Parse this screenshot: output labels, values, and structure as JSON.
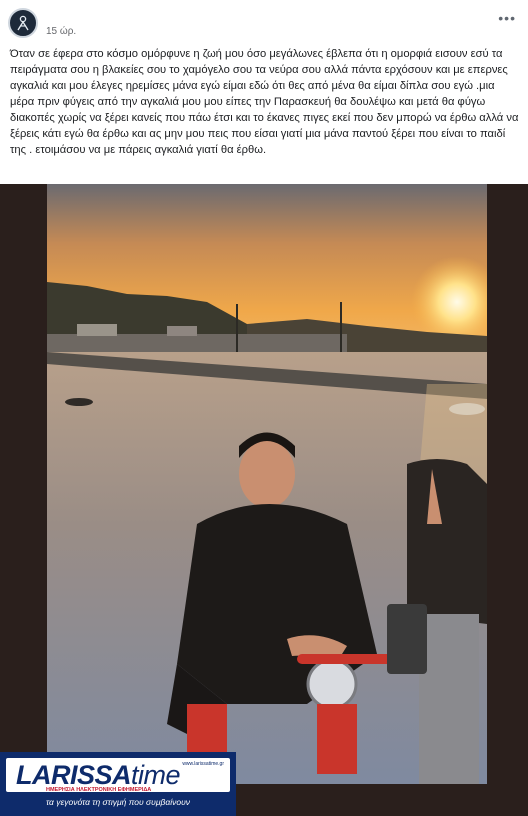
{
  "post": {
    "timestamp": "15 ώρ.",
    "more_icon": "more-horizontal-icon",
    "more_label": "•••",
    "text": "Όταν σε έφερα στο κόσμο ομόρφυνε η ζωή μου όσο μεγάλωνες έβλεπα ότι η ομορφιά εισουν εσύ τα πειράγματα σου η βλακείες σου το χαμόγελο σου τα νεύρα σου αλλά πάντα ερχόσουν και με επερνες αγκαλιά και μου έλεγες ηρεμίσες μάνα εγώ είμαι εδώ ότι θες από μένα θα είμαι δίπλα σου εγώ .μια μέρα πριν φύγεις από την αγκαλιά μου μου είπες την Παρασκευή θα δουλέψω και μετά θα φύγω διακοπές χωρίς να ξέρει κανείς που πάω έτσι και το έκανες πιγες εκεί που δεν μπορώ να έρθω αλλά να ξέρεις κάτι εγώ θα έρθω και ας μην μου πεις που είσαι γιατί μια μάνα παντού ξέρει που είναι το παιδί της . ετοιμάσου να με πάρεις αγκαλιά γιατί θα έρθω."
  },
  "watermark": {
    "brand_main": "LARISSA",
    "brand_time": "time",
    "url": "www.larissatime.gr",
    "subtitle": "ΗΜΕΡΗΣΙΑ ΗΛΕΚΤΡΟΝΙΚΗ ΕΦΗΜΕΡΙΔΑ",
    "tagline": "τα γεγονότα τη στιγμή που συμβαίνουν"
  },
  "colors": {
    "brand_blue": "#0e2b6b",
    "brand_red": "#c2172d",
    "text": "#1c1e21",
    "muted": "#65676b"
  }
}
